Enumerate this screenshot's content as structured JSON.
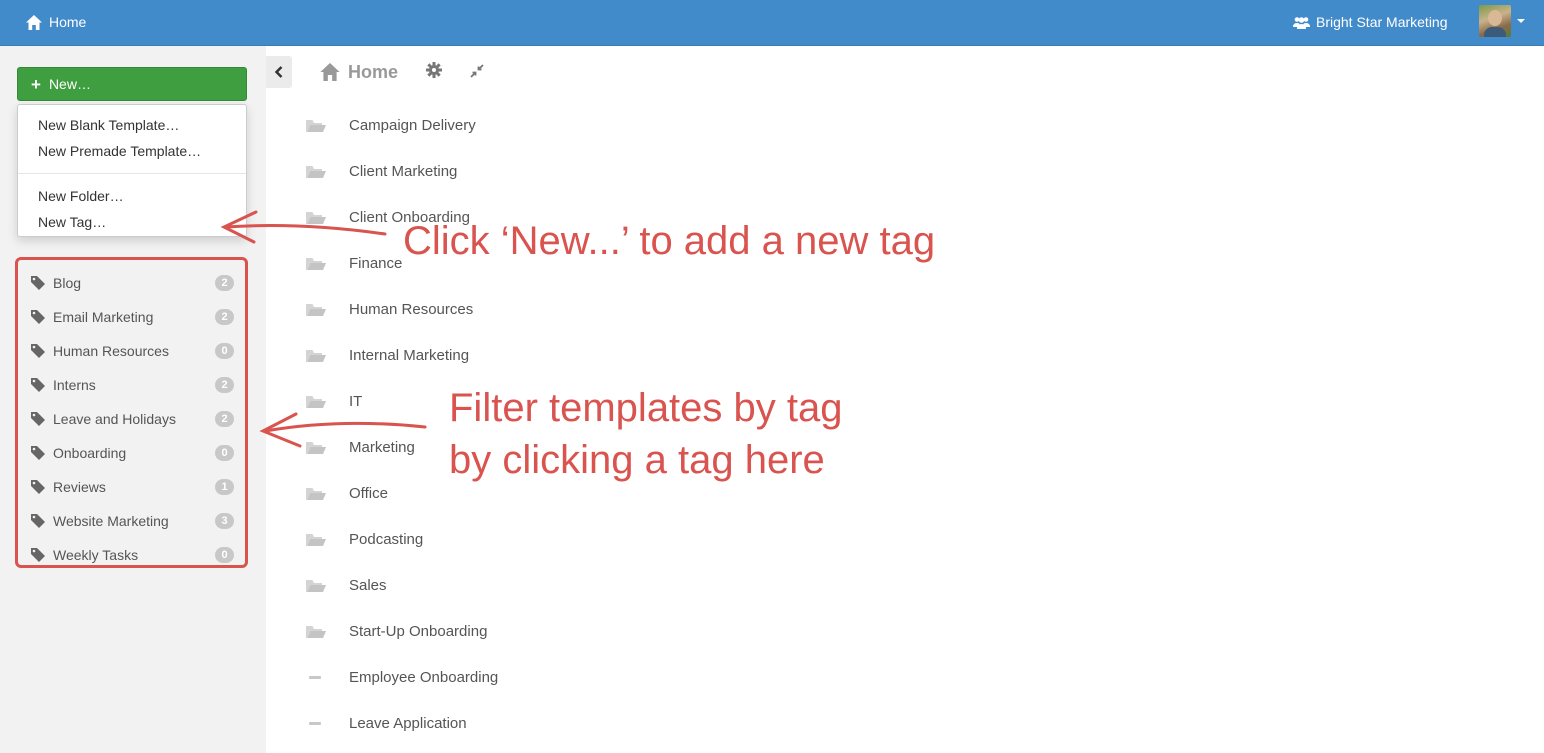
{
  "topbar": {
    "home_label": "Home",
    "org_label": "Bright Star Marketing"
  },
  "sidebar": {
    "new_button_label": "New…",
    "new_menu": {
      "blank_template": "New Blank Template…",
      "premade_template": "New Premade Template…",
      "folder": "New Folder…",
      "tag": "New Tag…"
    },
    "tags": [
      {
        "label": "Blog",
        "count": "2"
      },
      {
        "label": "Email Marketing",
        "count": "2"
      },
      {
        "label": "Human Resources",
        "count": "0"
      },
      {
        "label": "Interns",
        "count": "2"
      },
      {
        "label": "Leave and Holidays",
        "count": "2"
      },
      {
        "label": "Onboarding",
        "count": "0"
      },
      {
        "label": "Reviews",
        "count": "1"
      },
      {
        "label": "Website Marketing",
        "count": "3"
      },
      {
        "label": "Weekly Tasks",
        "count": "0"
      }
    ]
  },
  "main": {
    "breadcrumb": "Home",
    "items": [
      {
        "label": "Campaign Delivery",
        "icon": "folder-open-icon"
      },
      {
        "label": "Client Marketing",
        "icon": "folder-open-icon"
      },
      {
        "label": "Client Onboarding",
        "icon": "folder-open-icon"
      },
      {
        "label": "Finance",
        "icon": "folder-open-icon"
      },
      {
        "label": "Human Resources",
        "icon": "folder-open-icon"
      },
      {
        "label": "Internal Marketing",
        "icon": "folder-open-icon"
      },
      {
        "label": "IT",
        "icon": "folder-open-icon"
      },
      {
        "label": "Marketing",
        "icon": "folder-open-icon"
      },
      {
        "label": "Office",
        "icon": "folder-open-icon"
      },
      {
        "label": "Podcasting",
        "icon": "folder-open-icon"
      },
      {
        "label": "Sales",
        "icon": "folder-open-icon"
      },
      {
        "label": "Start-Up Onboarding",
        "icon": "folder-open-icon"
      },
      {
        "label": "Employee Onboarding",
        "icon": "template-dash-icon"
      },
      {
        "label": "Leave Application",
        "icon": "template-dash-icon"
      }
    ]
  },
  "annotations": {
    "new_tag_hint": "Click ‘New...’ to add a new tag",
    "filter_hint_line1": "Filter templates by tag",
    "filter_hint_line2": "by clicking a tag here"
  },
  "colors": {
    "nav_blue": "#428bca",
    "new_green": "#3f9e3f",
    "annotation_red": "#d9534f"
  }
}
